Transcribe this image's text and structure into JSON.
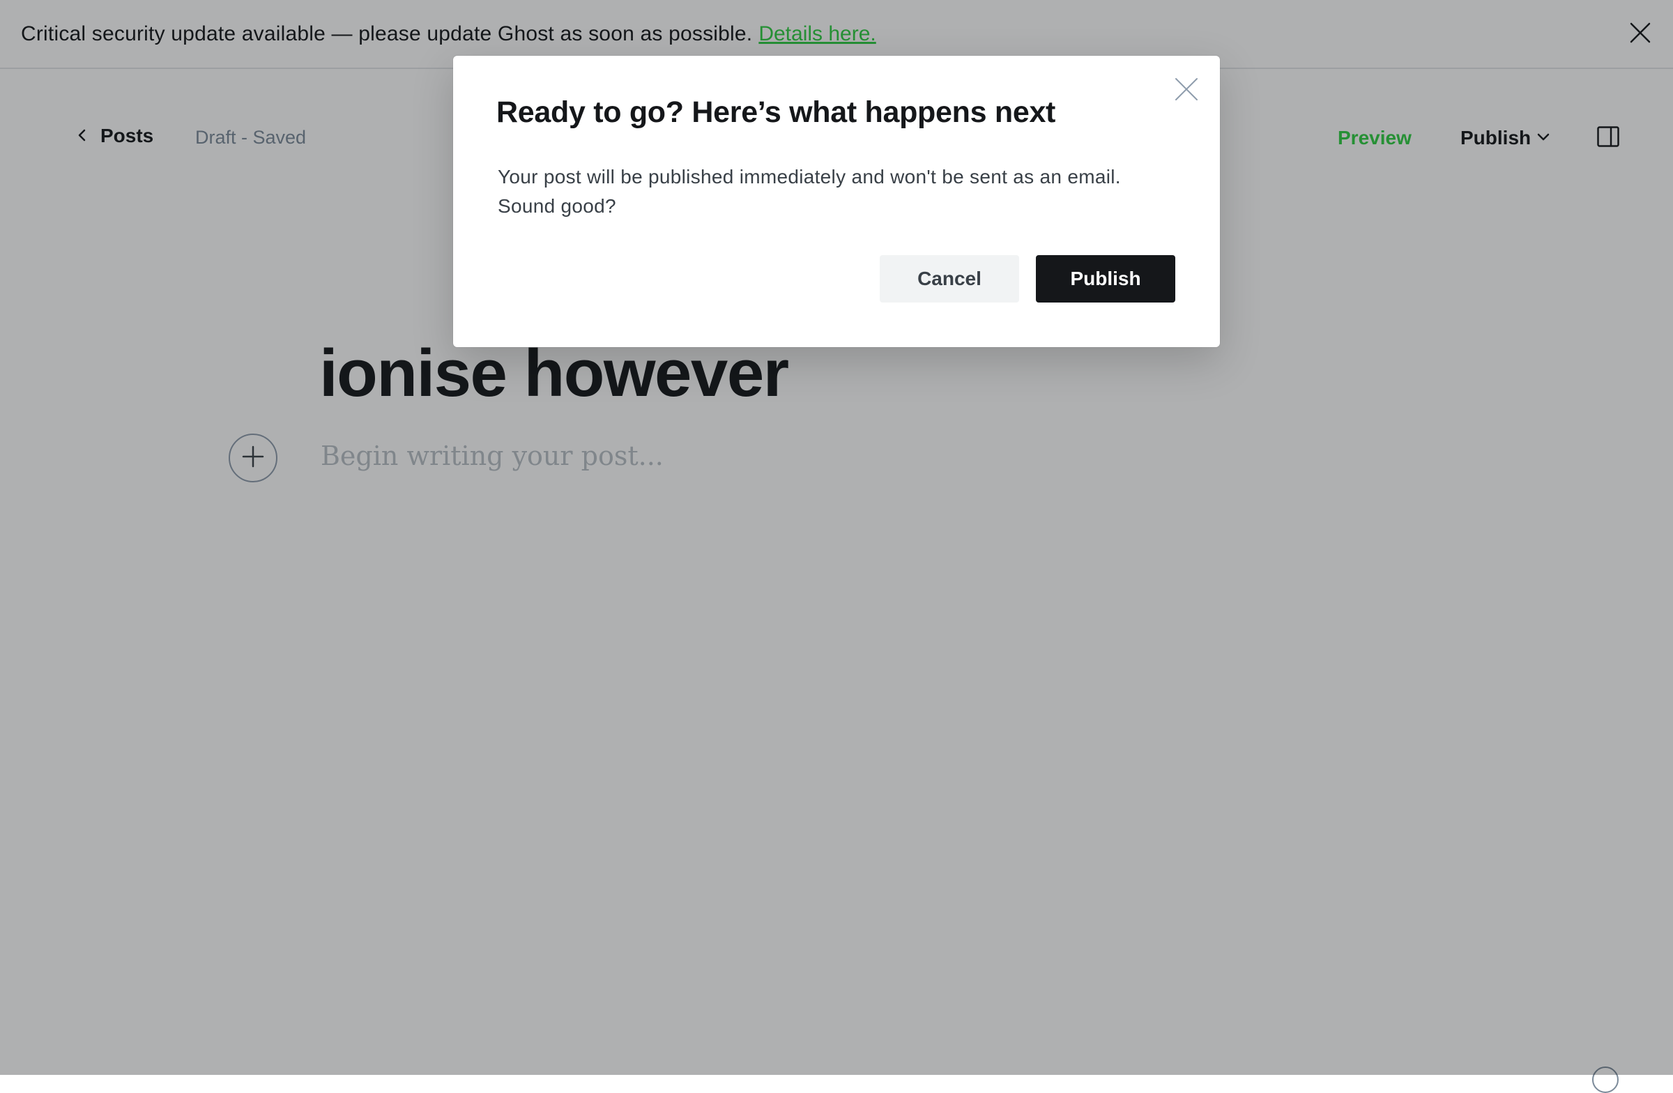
{
  "banner": {
    "message": "Critical security update available — please update Ghost as soon as possible.",
    "link_label": "Details here.",
    "close_icon": "close-icon",
    "link_color": "#30cf43"
  },
  "header": {
    "back_label": "Posts",
    "back_icon": "chevron-left-icon",
    "status": "Draft - Saved",
    "preview_label": "Preview",
    "publish_label": "Publish",
    "publish_icon": "chevron-down-icon",
    "sidebar_icon": "sidebar-toggle-icon",
    "accent_color": "#30cf43"
  },
  "editor": {
    "title": "ionise however",
    "body_placeholder": "Begin writing your post...",
    "add_card_icon": "plus-icon"
  },
  "modal": {
    "title": "Ready to go? Here’s what happens next",
    "body": "Your post will be published immediately and won't be sent as an email. Sound good?",
    "cancel_label": "Cancel",
    "publish_label": "Publish",
    "close_icon": "close-icon"
  }
}
